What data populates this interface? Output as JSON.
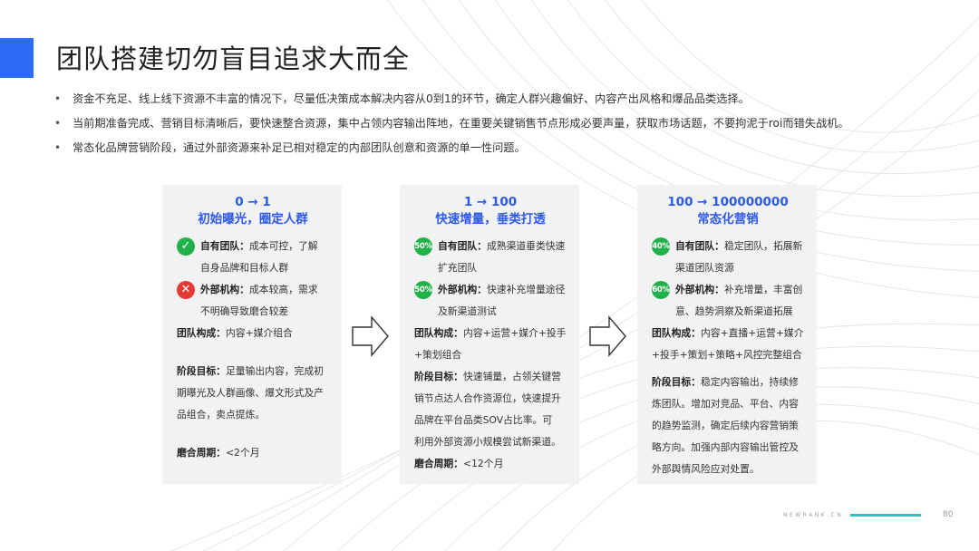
{
  "title": "团队搭建切勿盲目追求大而全",
  "bullets": [
    "资金不充足、线上线下资源不丰富的情况下，尽量低决策成本解决内容从0到1的环节，确定人群兴趣偏好、内容产出风格和爆品品类选择。",
    "当前期准备完成、营销目标清晰后，要快速整合资源，集中占领内容输出阵地，在重要关键销售节点形成必要声量，获取市场话题，不要拘泥于roi而错失战机。",
    "常态化品牌营销阶段，通过外部资源来补足已相对稳定的内部团队创意和资源的单一性问题。"
  ],
  "bullet_marker": "•",
  "cards": [
    {
      "range": "0 → 1",
      "phase": "初始曝光，圈定人群",
      "internal_icon": "✓",
      "internal_label": "自有团队：",
      "internal_line1": "成本可控，了解",
      "internal_line2": "自身品牌和目标人群",
      "external_icon": "✕",
      "external_label": "外部机构：",
      "external_line1": "成本较高，需求",
      "external_line2": "不明确导致磨合较差",
      "compose_label": "团队构成：",
      "compose_line1": "内容+媒介组合",
      "goal_label": "阶段目标：",
      "goal_line1": "足量输出内容，完成初",
      "goal_line2": "期曝光及人群画像、爆文形式及产",
      "goal_line3": "品组合，卖点提炼。",
      "period_label": "磨合周期：",
      "period_value": "<2个月"
    },
    {
      "range": "1 → 100",
      "phase": "快速增量，垂类打透",
      "internal_icon": "50%",
      "internal_label": "自有团队：",
      "internal_line1": "成熟渠道垂类快速",
      "internal_line2": "扩充团队",
      "external_icon": "50%",
      "external_label": "外部机构：",
      "external_line1": "快速补充增量途径",
      "external_line2": "及新渠道测试",
      "compose_label": "团队构成：",
      "compose_line1": "内容+运营+媒介+投手",
      "compose_line2": "+策划组合",
      "goal_label": "阶段目标：",
      "goal_line1": "快速铺量，占领关键营",
      "goal_line2": "销节点达人合作资源位，快速提升",
      "goal_line3": "品牌在平台品类SOV占比率。可",
      "goal_line4": "利用外部资源小规模尝试新渠道。",
      "period_label": "磨合周期：",
      "period_value": "<12个月"
    },
    {
      "range": "100 → 100000000",
      "phase": "常态化营销",
      "internal_icon": "40%",
      "internal_label": "自有团队：",
      "internal_line1": "稳定团队，拓展新",
      "internal_line2": "渠道团队资源",
      "external_icon": "60%",
      "external_label": "外部机构：",
      "external_line1": "补充增量，丰富创",
      "external_line2": "意、趋势洞察及新渠道拓展",
      "compose_label": "团队构成：",
      "compose_line1": "内容+直播+运营+媒介",
      "compose_line2": "+投手+策划+策略+风控完整组合",
      "goal_label": "阶段目标：",
      "goal_line1": "稳定内容输出，持续修",
      "goal_line2": "炼团队。增加对竞品、平台、内容",
      "goal_line3": "的趋势监测，确定后续内容营销策",
      "goal_line4": "略方向。加强内部内容输出管控及",
      "goal_line5": "外部舆情风险应对处置。"
    }
  ],
  "footer": {
    "brand": "NEWRANK.CN",
    "page": "80"
  },
  "colors": {
    "accent": "#2f6cf6",
    "heading_blue": "#2f59e8",
    "green": "#21b04a",
    "red": "#e53935",
    "teal": "#27c3c6"
  }
}
